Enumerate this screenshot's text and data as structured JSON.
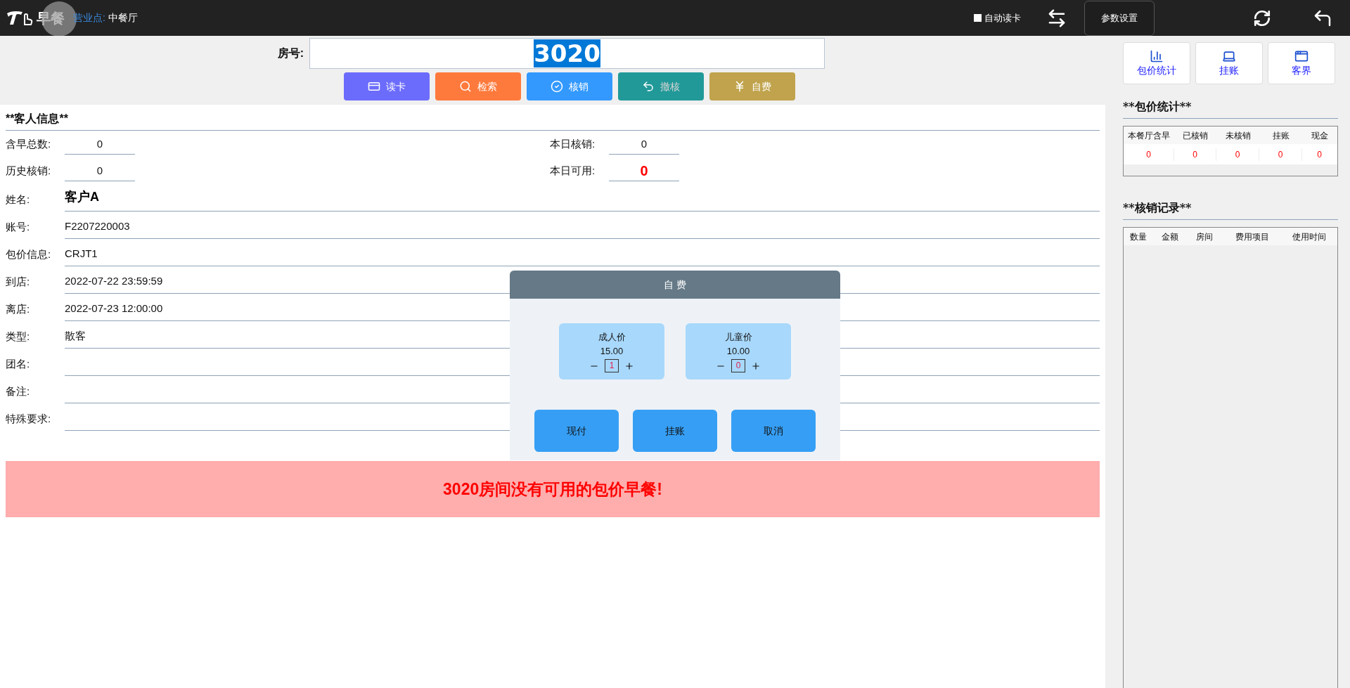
{
  "top_bar": {
    "logo": "早餐",
    "outlet_label": "营业点:",
    "outlet": "中餐厅",
    "auto_read": {
      "label": "自动读卡",
      "checked": false
    },
    "settings_button": "参数设置"
  },
  "room": {
    "label": "房号:",
    "value": "3020"
  },
  "actions": [
    {
      "label": "读卡",
      "kind": "card",
      "color": "#6c6cfc",
      "disabled": false
    },
    {
      "label": "检索",
      "kind": "search",
      "color": "#fe7a3c",
      "disabled": false
    },
    {
      "label": "核销",
      "kind": "check",
      "color": "#3399fe",
      "disabled": false
    },
    {
      "label": "撤核",
      "kind": "undo",
      "color": "#229999",
      "disabled": true
    },
    {
      "label": "自费",
      "kind": "yen",
      "color": "#c0a34c",
      "disabled": false
    }
  ],
  "guest_info": {
    "title": "**客人信息**",
    "counters": [
      {
        "label": "含早总数:",
        "value": "0",
        "alert": false
      },
      {
        "label": "本日核销:",
        "value": "0",
        "alert": false
      },
      {
        "label": "历史核销:",
        "value": "0",
        "alert": false
      },
      {
        "label": "本日可用:",
        "value": "0",
        "alert": true
      }
    ],
    "fields": [
      {
        "label": "姓名:",
        "value": "客户A",
        "emphasis": true
      },
      {
        "label": "账号:",
        "value": "F2207220003"
      },
      {
        "label": "包价信息:",
        "value": "CRJT1"
      },
      {
        "label": "到店:",
        "value": "2022-07-22 23:59:59"
      },
      {
        "label": "离店:",
        "value": "2022-07-23 12:00:00"
      },
      {
        "label": "类型:",
        "value": "散客"
      },
      {
        "label": "团名:"
      },
      {
        "label": "备注:"
      },
      {
        "label": "特殊要求:"
      }
    ]
  },
  "alert": "3020房间没有可用的包价早餐!",
  "dialog": {
    "title": "自 费",
    "items": [
      {
        "label": "成人价",
        "price": "15.00",
        "quantity": "1"
      },
      {
        "label": "儿童价",
        "price": "10.00",
        "quantity": "0"
      }
    ],
    "buttons": [
      "现付",
      "挂账",
      "取消"
    ]
  },
  "side_buttons": [
    {
      "label": "包价统计",
      "kind": "chart"
    },
    {
      "label": "挂账",
      "kind": "laptop"
    },
    {
      "label": "客界",
      "kind": "window"
    }
  ],
  "package_stats": {
    "title": "**包价统计**",
    "columns": [
      "本餐厅含早",
      "已核销",
      "未核销",
      "挂账",
      "现金"
    ],
    "row": [
      "0",
      "0",
      "0",
      "0",
      "0"
    ]
  },
  "records": {
    "title": "**核销记录**",
    "columns": [
      "数量",
      "金额",
      "房间",
      "费用项目",
      "使用时间"
    ]
  }
}
